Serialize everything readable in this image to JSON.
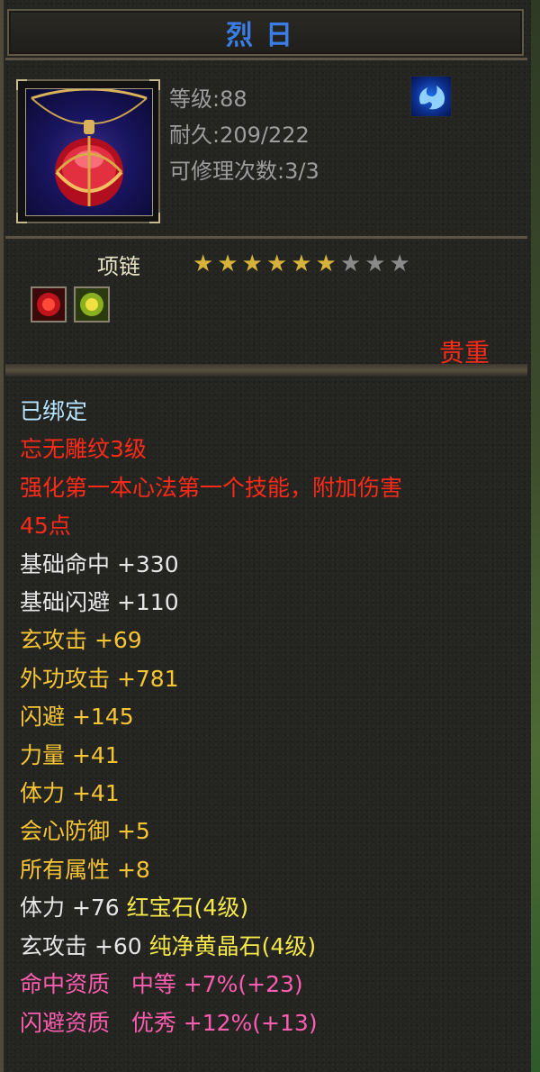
{
  "item": {
    "name": "烈日",
    "icon": "red-gem-pendant-icon",
    "level_line": "等级:88",
    "durability_line": "耐久:209/222",
    "repair_line": "可修理次数:3/3",
    "school_icon": "blue-flame-school-icon",
    "type": "项链",
    "stars_lit": 6,
    "stars_total": 9,
    "gem_icons": [
      "red-gem-slot-icon",
      "yellow-gem-slot-icon"
    ],
    "quality": "贵重"
  },
  "attributes": [
    {
      "text": "已绑定",
      "color": "#b8e4ff"
    },
    {
      "text": "忘无雕纹3级",
      "color": "#ff2a18"
    },
    {
      "text": "强化第一本心法第一个技能，附加伤害",
      "color": "#ff2a18"
    },
    {
      "text": "45点",
      "color": "#ff2a18"
    },
    {
      "text": "基础命中 +330",
      "color": "#e6e6e6"
    },
    {
      "text": "基础闪避 +110",
      "color": "#e6e6e6"
    },
    {
      "text": "玄攻击 +69",
      "color": "#f7c534"
    },
    {
      "text": "外功攻击 +781",
      "color": "#f7c534"
    },
    {
      "text": "闪避 +145",
      "color": "#f7c534"
    },
    {
      "text": "力量 +41",
      "color": "#f7c534"
    },
    {
      "text": "体力 +41",
      "color": "#f7c534"
    },
    {
      "text": "会心防御 +5",
      "color": "#f7c534"
    },
    {
      "text": "所有属性 +8",
      "color": "#f7c534"
    }
  ],
  "gem_attrs": [
    {
      "stat": "体力 +76",
      "gem": "红宝石(4级)"
    },
    {
      "stat": "玄攻击 +60",
      "gem": "纯净黄晶石(4级)"
    }
  ],
  "aptitudes": [
    {
      "text": "命中资质   中等 +7%(+23)"
    },
    {
      "text": "闪避资质   优秀 +12%(+13)"
    }
  ],
  "colors": {
    "title": "#3b7de6",
    "gray_text": "#9d9d9d",
    "gem_text": "#f4e84a",
    "aptitude": "#ff5db0",
    "star_lit": "#d6b23a",
    "star_dim": "#8a8a8a"
  }
}
